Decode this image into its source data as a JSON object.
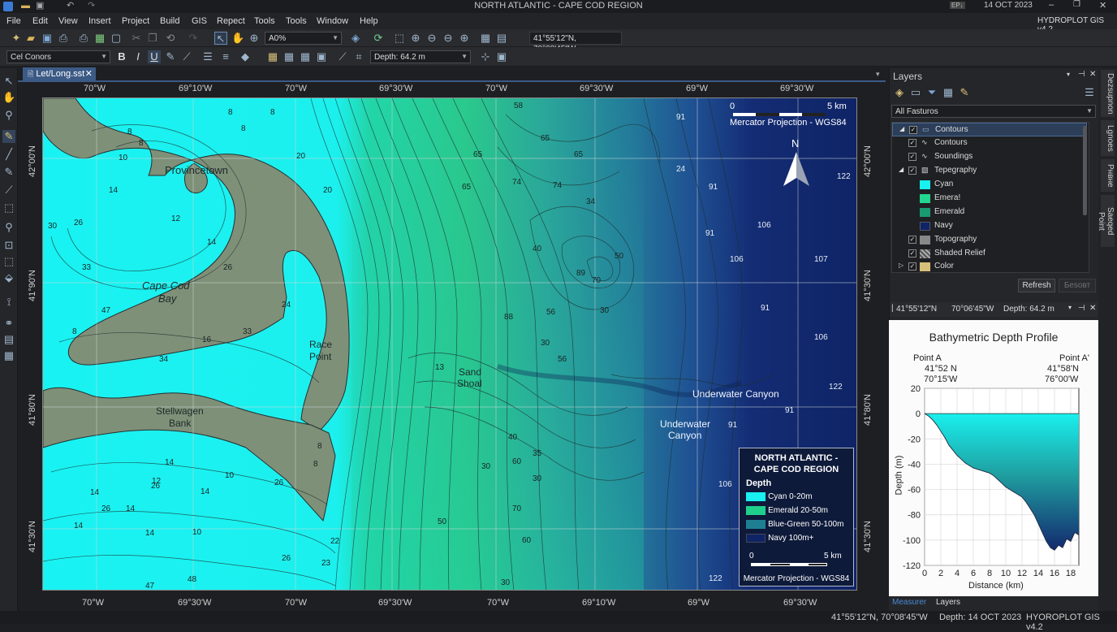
{
  "titlebar": {
    "title": "NORTH ATLANTIC - CAPE COD REGION",
    "badge": "EP↓",
    "date": "14 OCT 2023",
    "app": "HYDROPLOT GIS v4.2"
  },
  "menu": [
    "File",
    "Edit",
    "View",
    "Insert",
    "Project",
    "Build",
    "GIS",
    "Repect",
    "Tools",
    "Tools",
    "Window",
    "Help"
  ],
  "toolbar": {
    "zoom": "A0%",
    "coords": "41°55'12\"N, 70°08'45\"W",
    "font": "Cel Conors",
    "depth": "Depth: 64.2 m"
  },
  "doc_tab": "Let/Long.sst",
  "axis": {
    "top": [
      "70°W",
      "69°10'W",
      "70°W",
      "69°30'W",
      "70°W",
      "69°30'W",
      "69°W",
      "69°30'W"
    ],
    "bottom": [
      "70°W",
      "69°30'W",
      "70°W",
      "69°30'W",
      "70°W",
      "69°10'W",
      "69°W",
      "69°30'W"
    ],
    "left": [
      "42°00'N",
      "41°90'N",
      "41°80'N",
      "41°30'N"
    ],
    "right": [
      "42°00'N",
      "41°30'N",
      "41°80'N",
      "41°30'N"
    ]
  },
  "map": {
    "places": {
      "provincetown": "Provincetown",
      "ccb1": "Cape Cod",
      "ccb2": "Bay",
      "race1": "Race",
      "race2": "Point",
      "stell1": "Stellwagen",
      "stell2": "Bank",
      "sand1": "Sand",
      "sand2": "Shoal",
      "canyon1": "Underwater Canyon",
      "canyon2a": "Underwater",
      "canyon2b": "Canyon"
    },
    "scale": {
      "zero": "0",
      "km": "5 km",
      "proj": "Mercator Projection - WGS84"
    },
    "north": "N",
    "depths": [
      {
        "t": "8",
        "x": 228,
        "y": 12
      },
      {
        "t": "8",
        "x": 280,
        "y": 12
      },
      {
        "t": "8",
        "x": 104,
        "y": 36
      },
      {
        "t": "8",
        "x": 244,
        "y": 32
      },
      {
        "t": "8",
        "x": 118,
        "y": 50
      },
      {
        "t": "10",
        "x": 93,
        "y": 68
      },
      {
        "t": "20",
        "x": 312,
        "y": 66
      },
      {
        "t": "14",
        "x": 81,
        "y": 108
      },
      {
        "t": "12",
        "x": 158,
        "y": 143
      },
      {
        "t": "30",
        "x": 6,
        "y": 152
      },
      {
        "t": "26",
        "x": 38,
        "y": 148
      },
      {
        "t": "14",
        "x": 202,
        "y": 172
      },
      {
        "t": "33",
        "x": 48,
        "y": 203
      },
      {
        "t": "26",
        "x": 222,
        "y": 203
      },
      {
        "t": "47",
        "x": 72,
        "y": 256
      },
      {
        "t": "24",
        "x": 294,
        "y": 249
      },
      {
        "t": "8",
        "x": 36,
        "y": 282
      },
      {
        "t": "16",
        "x": 196,
        "y": 292
      },
      {
        "t": "33",
        "x": 246,
        "y": 282
      },
      {
        "t": "34",
        "x": 143,
        "y": 316
      },
      {
        "t": "20",
        "x": 345,
        "y": 108
      },
      {
        "t": "8",
        "x": 338,
        "y": 423
      },
      {
        "t": "8",
        "x": 333,
        "y": 445
      },
      {
        "t": "14",
        "x": 150,
        "y": 443
      },
      {
        "t": "10",
        "x": 224,
        "y": 459
      },
      {
        "t": "12",
        "x": 134,
        "y": 466
      },
      {
        "t": "26",
        "x": 133,
        "y": 472
      },
      {
        "t": "14",
        "x": 194,
        "y": 479
      },
      {
        "t": "26",
        "x": 285,
        "y": 468
      },
      {
        "t": "14",
        "x": 58,
        "y": 480
      },
      {
        "t": "26",
        "x": 72,
        "y": 500
      },
      {
        "t": "14",
        "x": 102,
        "y": 500
      },
      {
        "t": "14",
        "x": 38,
        "y": 521
      },
      {
        "t": "14",
        "x": 126,
        "y": 530
      },
      {
        "t": "10",
        "x": 184,
        "y": 529
      },
      {
        "t": "26",
        "x": 294,
        "y": 561
      },
      {
        "t": "23",
        "x": 343,
        "y": 567
      },
      {
        "t": "47",
        "x": 126,
        "y": 595
      },
      {
        "t": "48",
        "x": 178,
        "y": 587
      },
      {
        "t": "58",
        "x": 580,
        "y": 4
      },
      {
        "t": "65",
        "x": 613,
        "y": 44
      },
      {
        "t": "65",
        "x": 654,
        "y": 64
      },
      {
        "t": "65",
        "x": 530,
        "y": 64
      },
      {
        "t": "74",
        "x": 578,
        "y": 98
      },
      {
        "t": "74",
        "x": 628,
        "y": 102
      },
      {
        "t": "34",
        "x": 669,
        "y": 122
      },
      {
        "t": "65",
        "x": 516,
        "y": 104
      },
      {
        "t": "40",
        "x": 603,
        "y": 180
      },
      {
        "t": "50",
        "x": 704,
        "y": 189
      },
      {
        "t": "70",
        "x": 676,
        "y": 219
      },
      {
        "t": "89",
        "x": 657,
        "y": 210
      },
      {
        "t": "30",
        "x": 686,
        "y": 256
      },
      {
        "t": "56",
        "x": 620,
        "y": 258
      },
      {
        "t": "88",
        "x": 568,
        "y": 264
      },
      {
        "t": "30",
        "x": 613,
        "y": 296
      },
      {
        "t": "56",
        "x": 634,
        "y": 316
      },
      {
        "t": "13",
        "x": 483,
        "y": 326
      },
      {
        "t": "40",
        "x": 573,
        "y": 412
      },
      {
        "t": "30",
        "x": 540,
        "y": 448
      },
      {
        "t": "60",
        "x": 578,
        "y": 442
      },
      {
        "t": "30",
        "x": 603,
        "y": 463
      },
      {
        "t": "70",
        "x": 578,
        "y": 500
      },
      {
        "t": "60",
        "x": 590,
        "y": 539
      },
      {
        "t": "30",
        "x": 564,
        "y": 591
      },
      {
        "t": "50",
        "x": 486,
        "y": 516
      },
      {
        "t": "35",
        "x": 603,
        "y": 432
      },
      {
        "t": "22",
        "x": 354,
        "y": 540
      }
    ],
    "depths_light": [
      {
        "t": "91",
        "x": 780,
        "y": 18
      },
      {
        "t": "122",
        "x": 978,
        "y": 91
      },
      {
        "t": "91",
        "x": 820,
        "y": 104
      },
      {
        "t": "24",
        "x": 780,
        "y": 82
      },
      {
        "t": "106",
        "x": 880,
        "y": 151
      },
      {
        "t": "91",
        "x": 816,
        "y": 161
      },
      {
        "t": "106",
        "x": 846,
        "y": 193
      },
      {
        "t": "107",
        "x": 950,
        "y": 193
      },
      {
        "t": "91",
        "x": 884,
        "y": 253
      },
      {
        "t": "106",
        "x": 950,
        "y": 289
      },
      {
        "t": "122",
        "x": 968,
        "y": 350
      },
      {
        "t": "91",
        "x": 914,
        "y": 379
      },
      {
        "t": "91",
        "x": 844,
        "y": 397
      },
      {
        "t": "106",
        "x": 832,
        "y": 470
      },
      {
        "t": "122",
        "x": 820,
        "y": 586
      }
    ]
  },
  "legend": {
    "title1": "NORTH ATLANTIC -",
    "title2": "CAPE COD REGION",
    "heading": "Depth",
    "items": [
      {
        "label": "Cyan 0-20m",
        "color": "#19f0f0"
      },
      {
        "label": "Emerald 20-50m",
        "color": "#1fcf8c"
      },
      {
        "label": "Blue-Green 50-100m",
        "color": "#1f7f92"
      },
      {
        "label": "Navy 100m+",
        "color": "#0f2466"
      }
    ],
    "zero": "0",
    "km": "5 km",
    "proj": "Mercator Projection - WGS84"
  },
  "layers": {
    "title": "Layers",
    "filter": "All Fasturos",
    "refresh": "Refresh",
    "reset": "Беsовт",
    "items": [
      {
        "label": "Contours",
        "selected": true,
        "indent": 1,
        "checked": true
      },
      {
        "label": "Contours",
        "indent": 2,
        "checked": true
      },
      {
        "label": "Soundings",
        "indent": 2,
        "checked": true
      },
      {
        "label": "Tepegraphy",
        "indent": 1,
        "checked": true
      },
      {
        "label": "Cyan",
        "indent": 3,
        "swatch": "#19f0f0"
      },
      {
        "label": "Emera!",
        "indent": 3,
        "swatch": "#22d68f"
      },
      {
        "label": "Emerald",
        "indent": 3,
        "swatch": "#1a9a70"
      },
      {
        "label": "Navy",
        "indent": 3,
        "swatch": "#0f2466"
      },
      {
        "label": "Topography",
        "indent": 2,
        "checked": true
      },
      {
        "label": "Shaded Relief",
        "indent": 2,
        "checked": true
      },
      {
        "label": "Color",
        "indent": 1,
        "checked": true
      }
    ]
  },
  "profile_header": {
    "lat": "41°55'12\"N",
    "lon": "70°06'45\"W",
    "depth": "Depth: 64.2 m"
  },
  "profile": {
    "title": "Bathymetric Depth Profile",
    "pointA": "Point A",
    "pointA_lat": "41°52 N",
    "pointA_lon": "70°15'W",
    "pointB": "Point A'",
    "pointB_lat": "41°58'N",
    "pointB_lon": "76°00'W",
    "ylabel": "Depth (m)",
    "xlabel": "Distance (km)"
  },
  "chart_data": {
    "type": "area",
    "title": "Bathymetric Depth Profile",
    "xlabel": "Distance (km)",
    "ylabel": "Depth (m)",
    "xlim": [
      0,
      19
    ],
    "ylim": [
      -120,
      20
    ],
    "xticks": [
      0,
      2,
      4,
      6,
      8,
      10,
      12,
      14,
      16,
      18
    ],
    "yticks": [
      20,
      0,
      -20,
      -40,
      -60,
      -80,
      -100,
      -120
    ],
    "x": [
      0,
      0.5,
      1,
      1.5,
      2,
      2.5,
      3,
      3.5,
      4,
      4.5,
      5,
      5.5,
      6,
      6.5,
      7,
      7.5,
      8,
      8.5,
      9,
      9.5,
      10,
      10.5,
      11,
      11.5,
      12,
      12.5,
      13,
      13.5,
      14,
      14.5,
      15,
      15.5,
      16,
      16.5,
      17,
      17.5,
      18,
      18.5,
      19
    ],
    "y": [
      0,
      -2,
      -5,
      -9,
      -14,
      -19,
      -25,
      -29,
      -33,
      -36,
      -39,
      -41,
      -43,
      -44,
      -45,
      -46,
      -47,
      -49,
      -52,
      -55,
      -58,
      -60,
      -62,
      -64,
      -66,
      -70,
      -75,
      -80,
      -87,
      -94,
      -101,
      -106,
      -108,
      -104,
      -106,
      -99,
      -101,
      -94,
      -96
    ]
  },
  "bottom_tabs": [
    "Measurer",
    "Layers"
  ],
  "sidetabs": [
    "Dezsupnon",
    "Lgnoes",
    "Рнвне",
    "Saeqed Point"
  ],
  "status": {
    "coords": "41°55'12\"N, 70°08'45\"W",
    "depth": "Depth: 14 OCT 2023",
    "app": "HYOROPLOT GIS v4.2"
  }
}
